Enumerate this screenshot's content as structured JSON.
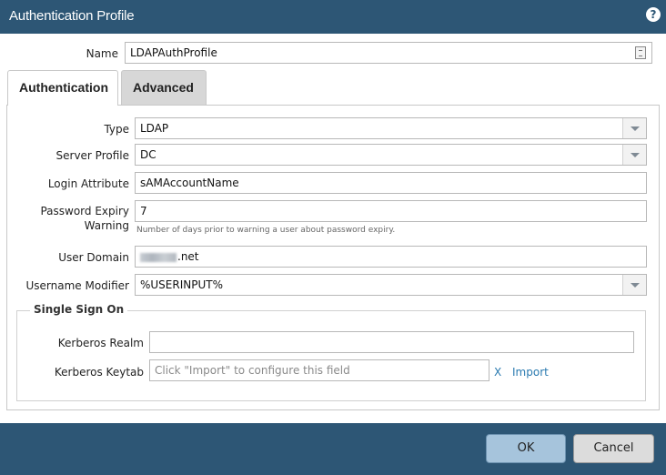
{
  "window": {
    "title": "Authentication Profile"
  },
  "name": {
    "label": "Name",
    "value": "LDAPAuthProfile"
  },
  "tabs": [
    {
      "label": "Authentication",
      "active": true
    },
    {
      "label": "Advanced",
      "active": false
    }
  ],
  "form": {
    "type": {
      "label": "Type",
      "value": "LDAP"
    },
    "server_profile": {
      "label": "Server Profile",
      "value": "DC"
    },
    "login_attribute": {
      "label": "Login Attribute",
      "value": "sAMAccountName"
    },
    "password_expiry": {
      "label_line1": "Password Expiry",
      "label_line2": "Warning",
      "value": "7",
      "hint": "Number of days prior to warning a user about password expiry."
    },
    "user_domain": {
      "label": "User Domain",
      "value_suffix": ".net"
    },
    "username_modifier": {
      "label": "Username Modifier",
      "value": "%USERINPUT%"
    }
  },
  "sso": {
    "legend": "Single Sign On",
    "kerberos_realm": {
      "label": "Kerberos Realm",
      "value": ""
    },
    "kerberos_keytab": {
      "label": "Kerberos Keytab",
      "placeholder": "Click \"Import\" to configure this field",
      "clear_label": "X",
      "import_label": "Import"
    }
  },
  "buttons": {
    "ok": "OK",
    "cancel": "Cancel"
  },
  "colors": {
    "header": "#2d5675",
    "footer": "#2d5675",
    "ok_button": "#a6c4dc",
    "link": "#2a7ab0"
  }
}
